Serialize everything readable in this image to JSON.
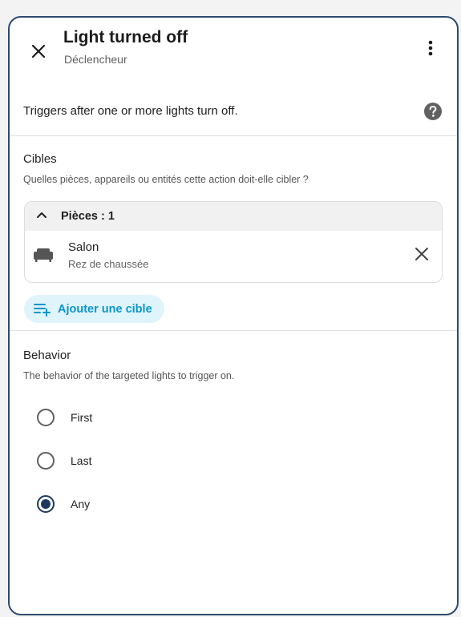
{
  "dialog": {
    "title": "Light turned off",
    "subtitle": "Déclencheur",
    "description": "Triggers after one or more lights turn off."
  },
  "targets": {
    "title": "Cibles",
    "description": "Quelles pièces, appareils ou entités cette action doit-elle cibler ?",
    "group_label": "Pièces : 1",
    "items": [
      {
        "name": "Salon",
        "floor": "Rez de chaussée",
        "icon": "sofa-icon"
      }
    ],
    "add_label": "Ajouter une cible"
  },
  "behavior": {
    "title": "Behavior",
    "description": "The behavior of the targeted lights to trigger on.",
    "options": [
      {
        "label": "First",
        "checked": false
      },
      {
        "label": "Last",
        "checked": false
      },
      {
        "label": "Any",
        "checked": true
      }
    ]
  },
  "colors": {
    "accent": "#0b96c9",
    "border": "#2d4a6e",
    "radio_checked": "#1f3a5f"
  }
}
